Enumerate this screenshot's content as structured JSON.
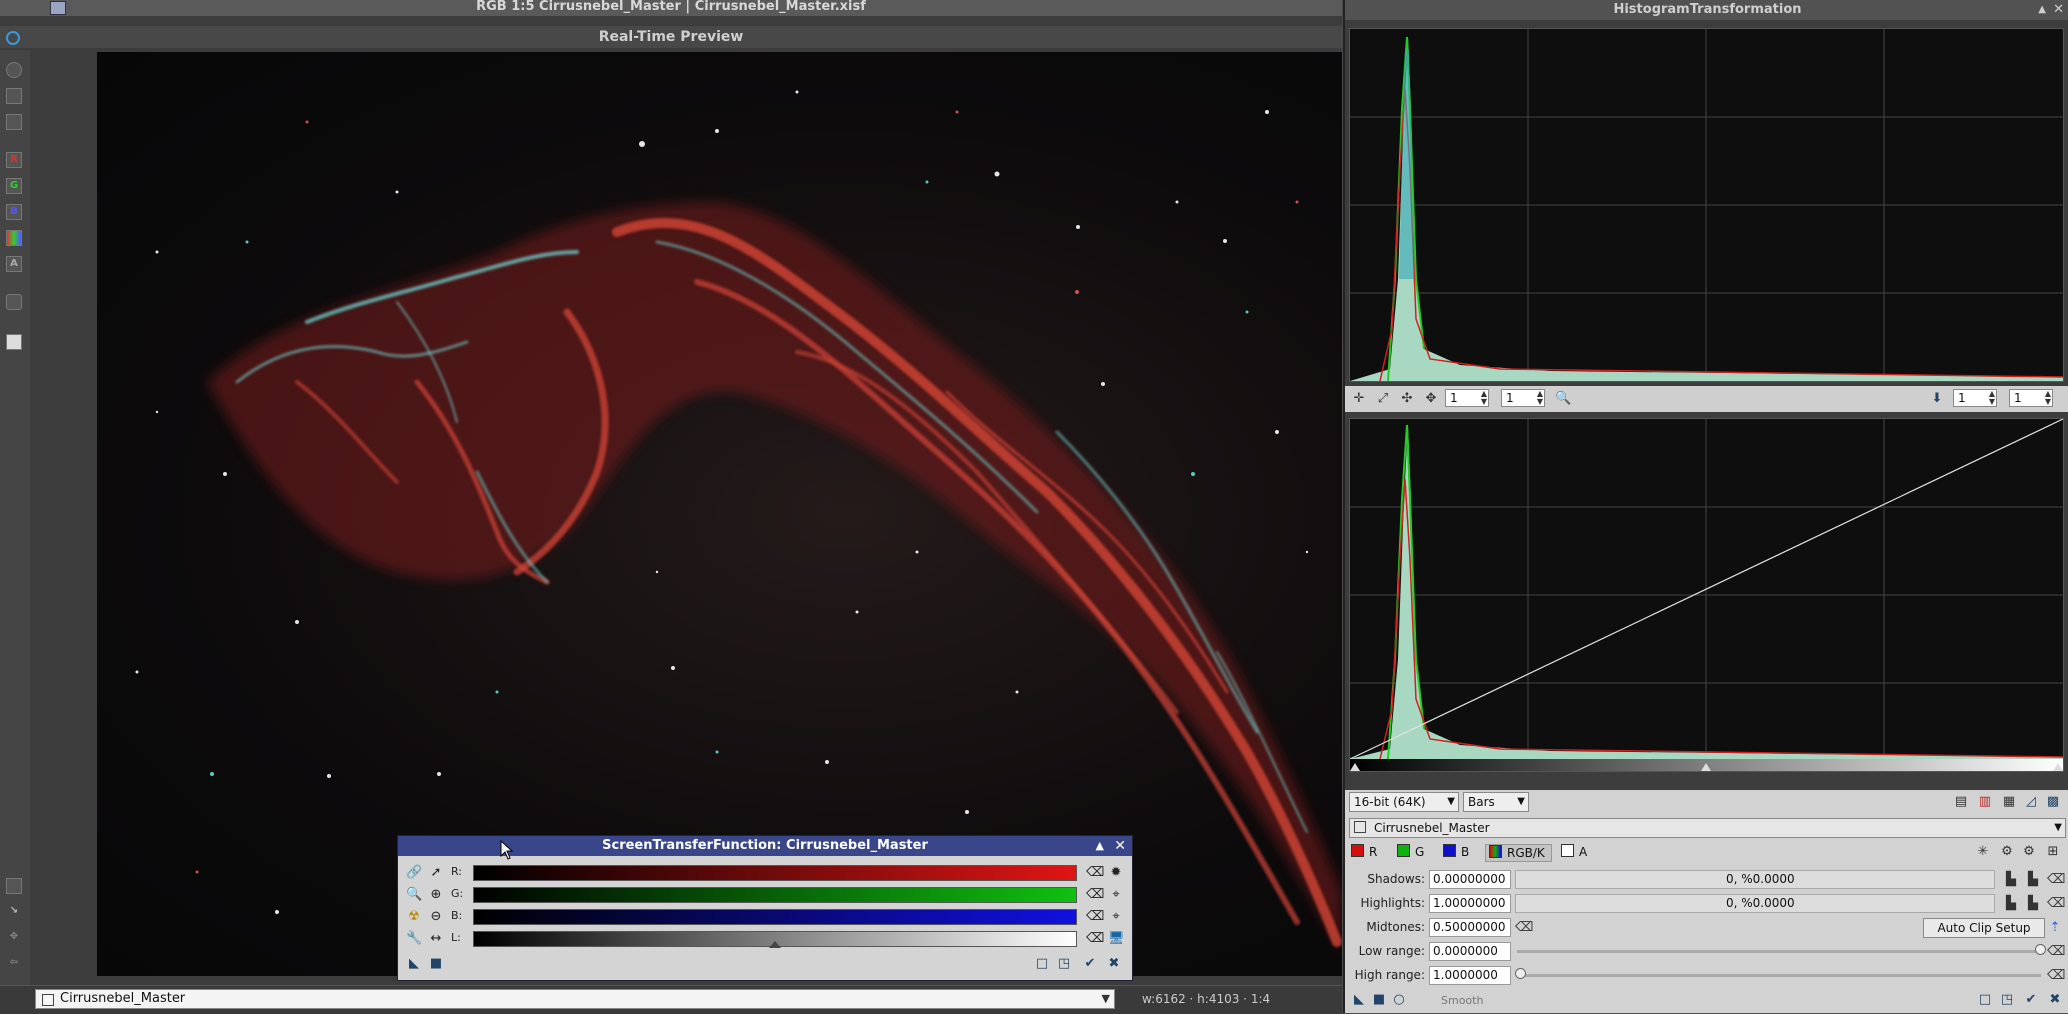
{
  "image_window": {
    "title": "RGB 1:5 Cirrusnebel_Master | Cirrusnebel_Master.xisf",
    "preview_label": "Real-Time Preview",
    "channel_buttons": [
      "R",
      "G",
      "B",
      "A"
    ],
    "view_select_value": "Cirrusnebel_Master",
    "geometry": "w:6162 · h:4103 · 1:4"
  },
  "stf": {
    "title": "ScreenTransferFunction: Cirrusnebel_Master",
    "rows": [
      {
        "label": "R:",
        "color": "#e01515"
      },
      {
        "label": "G:",
        "color": "#10c010"
      },
      {
        "label": "B:",
        "color": "#1010e0"
      },
      {
        "label": "L:",
        "color": "#ffffff"
      }
    ],
    "midtone_marker_fraction": 0.5
  },
  "histogram": {
    "title": "HistogramTransformation",
    "zoom_h": "1",
    "zoom_v": "1",
    "zoom_h2": "1",
    "zoom_v2": "1",
    "resolution": "16-bit (64K)",
    "graph_style": "Bars",
    "view": "Cirrusnebel_Master",
    "channels": [
      {
        "label": "R",
        "color": "#d01010"
      },
      {
        "label": "G",
        "color": "#10b010"
      },
      {
        "label": "B",
        "color": "#1010c8"
      },
      {
        "label": "RGB/K",
        "color": "#888888"
      },
      {
        "label": "A",
        "color": "#ffffff"
      }
    ],
    "shadows_label": "Shadows:",
    "shadows": "0.00000000",
    "shadows_clip": "0, %0.0000",
    "highlights_label": "Highlights:",
    "highlights": "1.00000000",
    "highlights_clip": "0, %0.0000",
    "midtones_label": "Midtones:",
    "midtones": "0.50000000",
    "auto_clip_button": "Auto Clip Setup",
    "low_range_label": "Low range:",
    "low_range": "0.0000000",
    "high_range_label": "High range:",
    "high_range": "1.0000000",
    "smooth_label": "Smooth",
    "colors": {
      "peak_fill": "#a9d8c2",
      "peak_edge_green": "#22cc22",
      "peak_edge_red": "#d02020"
    }
  }
}
